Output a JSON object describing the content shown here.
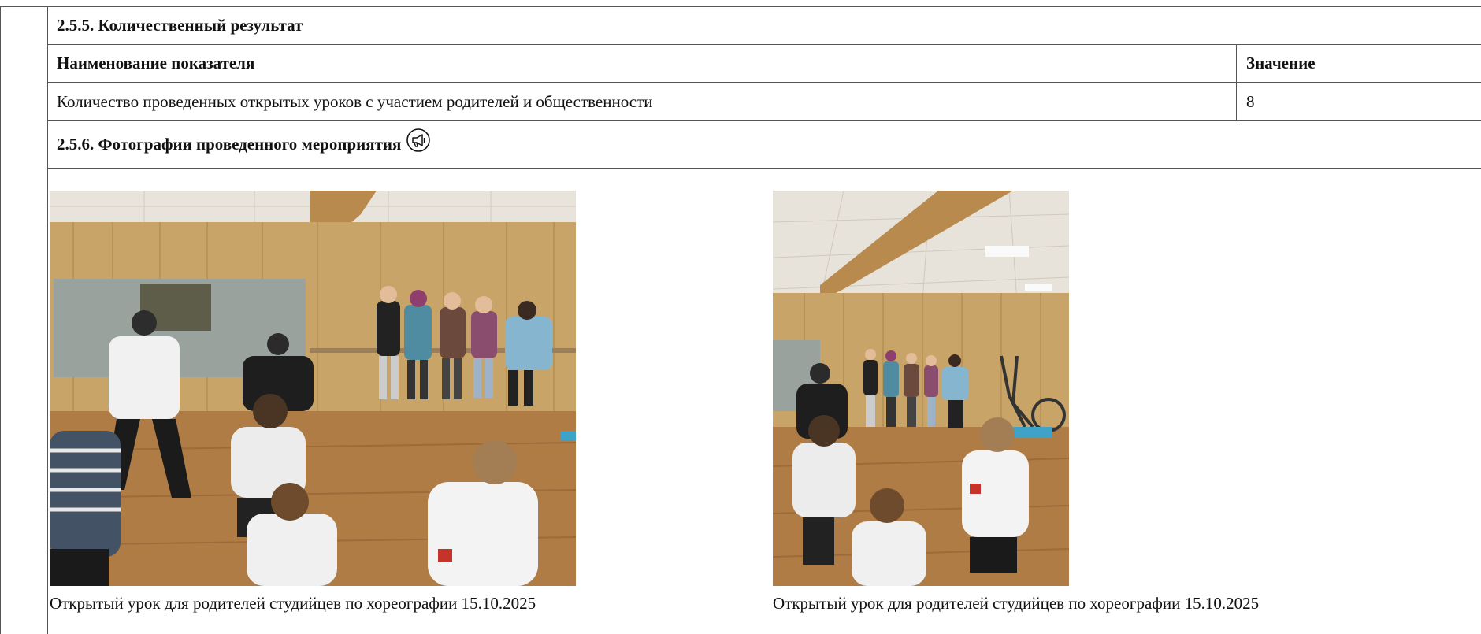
{
  "section_quantitative": {
    "heading": "2.5.5. Количественный результат",
    "col_name_header": "Наименование показателя",
    "col_value_header": "Значение",
    "rows": [
      {
        "name": "Количество проведенных открытых уроков с участием родителей и общественности",
        "value": "8"
      }
    ]
  },
  "section_photos": {
    "heading": "2.5.6. Фотографии проведенного мероприятия",
    "heading_icon": "megaphone-icon",
    "photos": [
      {
        "caption": "Открытый урок для родителей студийцев по хореографии 15.10.2025"
      },
      {
        "caption": "Открытый урок для родителей студийцев по хореографии 15.10.2025"
      }
    ]
  },
  "colors": {
    "border": "#555555",
    "text": "#111111",
    "wall": "#c8a468",
    "floor": "#b07c45",
    "ceiling": "#e8e4dc"
  }
}
